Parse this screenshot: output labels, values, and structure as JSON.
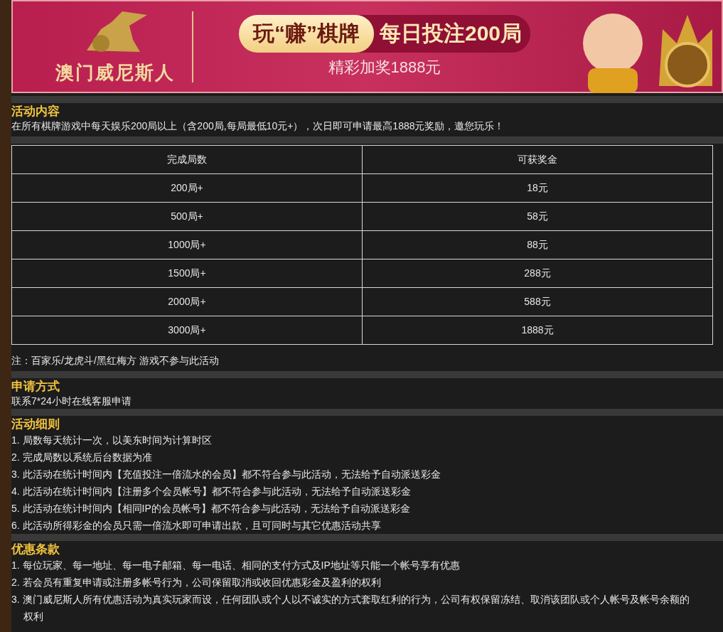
{
  "banner": {
    "brand": "澳门威尼斯人",
    "slogan_left": "玩“赚”棋牌",
    "slogan_right": "每日投注200局",
    "subtitle": "精彩加奖1888元"
  },
  "sections": [
    {
      "kind": "table",
      "title": "活动内容",
      "text": "在所有棋牌游戏中每天娱乐200局以上（含200局,每局最低10元+），次日即可申请最高1888元奖励，邀您玩乐！",
      "columns": [
        "完成局数",
        "可获奖金"
      ],
      "rows": [
        [
          "200局+",
          "18元"
        ],
        [
          "500局+",
          "58元"
        ],
        [
          "1000局+",
          "88元"
        ],
        [
          "1500局+",
          "288元"
        ],
        [
          "2000局+",
          "588元"
        ],
        [
          "3000局+",
          "1888元"
        ]
      ],
      "note": "注：百家乐/龙虎斗/黑红梅方 游戏不参与此活动"
    },
    {
      "kind": "text",
      "title": "申请方式",
      "text": "联系7*24小时在线客服申请"
    },
    {
      "kind": "list",
      "title": "活动细则",
      "items": [
        "1. 局数每天统计一次，以美东时间为计算时区",
        "2. 完成局数以系统后台数据为准",
        "3. 此活动在统计时间内【充值投注一倍流水的会员】都不符合参与此活动，无法给予自动派送彩金",
        "4. 此活动在统计时间内【注册多个会员帐号】都不符合参与此活动，无法给予自动派送彩金",
        "5. 此活动在统计时间内【相同IP的会员帐号】都不符合参与此活动，无法给予自动派送彩金",
        "6. 此活动所得彩金的会员只需一倍流水即可申请出款，且可同时与其它优惠活动共享"
      ]
    },
    {
      "kind": "list",
      "title": "优惠条款",
      "items": [
        "1. 每位玩家、每一地址、每一电子邮箱、每一电话、相同的支付方式及IP地址等只能一个帐号享有优惠",
        "2. 若会员有重复申请或注册多帐号行为，公司保留取消或收回优惠彩金及盈利的权利",
        "3. 澳门威尼斯人所有优惠活动为真实玩家而设，任何团队或个人以不诚实的方式套取红利的行为，公司有权保留冻结、取消该团队或个人帐号及帐号余额的权利"
      ]
    }
  ]
}
